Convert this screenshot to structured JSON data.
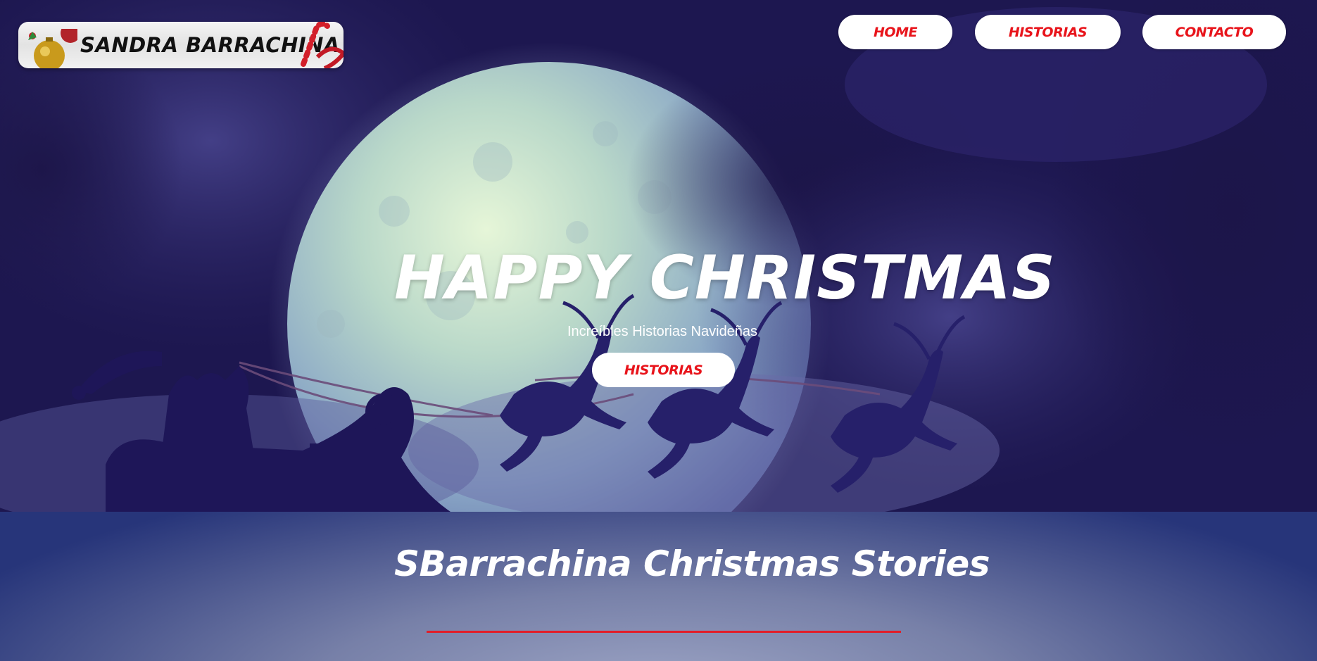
{
  "header": {
    "logo_text": "SANDRA BARRACHINA",
    "nav": [
      {
        "label": "HOME"
      },
      {
        "label": "HISTORIAS"
      },
      {
        "label": "CONTACTO"
      }
    ]
  },
  "hero": {
    "title": "HAPPY CHRISTMAS",
    "subtitle": "Increíbles Historias Navideñas",
    "button_label": "HISTORIAS"
  },
  "section": {
    "title": "SBarrachina Christmas Stories"
  },
  "colors": {
    "accent": "#e8141b",
    "button_bg": "#ffffff",
    "night_sky": "#1a1446",
    "moon": "#cfe6d8",
    "underline": "#e21d28"
  }
}
